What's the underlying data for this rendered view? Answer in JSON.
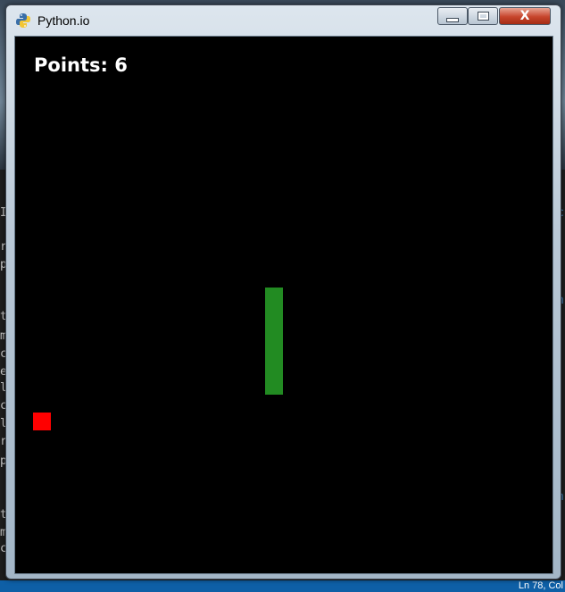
{
  "window": {
    "title": "Python.io",
    "close_glyph": "X"
  },
  "game": {
    "score_text": "Points: 6",
    "snake_color": "#228b22",
    "food_color": "#ff0000",
    "background_color": "#000000"
  },
  "background_editor": {
    "status_text": "Ln 78, Col"
  },
  "icons": [
    "python-icon",
    "minimize-icon",
    "maximize-icon",
    "close-icon"
  ]
}
